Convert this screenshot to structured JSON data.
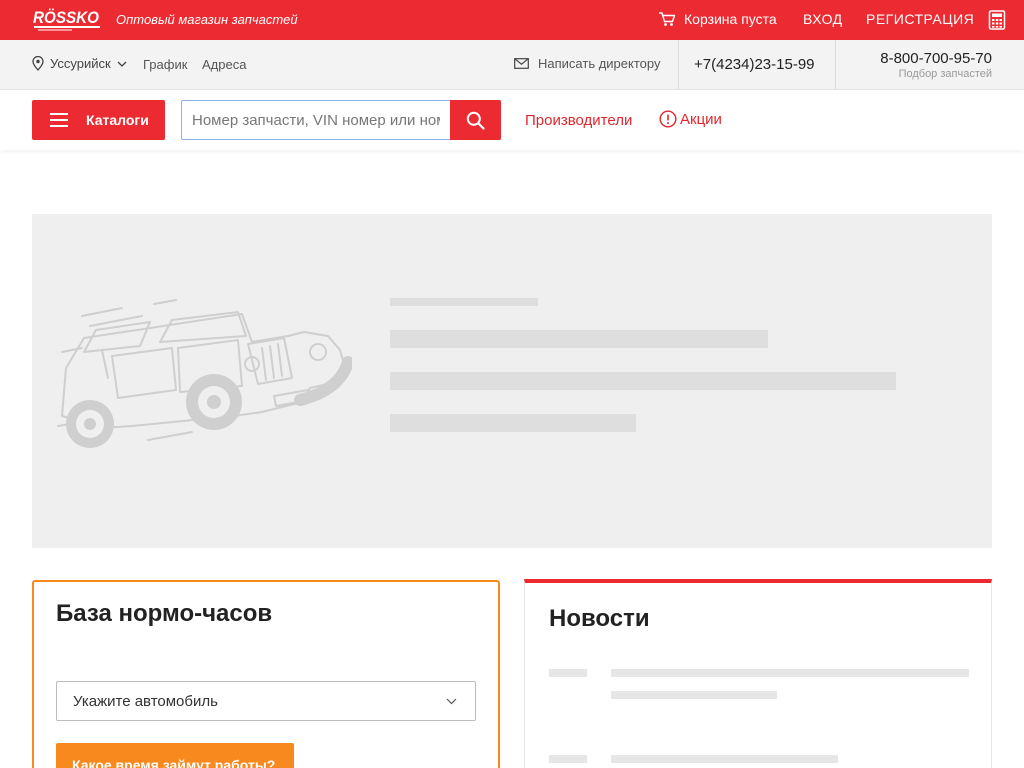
{
  "header": {
    "logo_text": "RÖSSKO",
    "tagline": "Оптовый магазин запчастей",
    "cart_label": "Корзина пуста",
    "login_label": "ВХОД",
    "register_label": "РЕГИСТРАЦИЯ",
    "brand_color": "#ec2a32"
  },
  "infobar": {
    "city": "Уссурийск",
    "schedule": "График",
    "addresses": "Адреса",
    "write_director": "Написать директору",
    "phone_local": "+7(4234)23-15-99",
    "phone_free": "8-800-700-95-70",
    "phone_free_caption": "Подбор запчастей"
  },
  "nav": {
    "catalog_label": "Каталоги",
    "search_placeholder": "Номер запчасти, VIN номер или номер кузова",
    "manufacturers_label": "Производители",
    "promo_label": "Акции"
  },
  "hours_card": {
    "title": "База нормо-часов",
    "car_select_value": "Укажите автомобиль",
    "button_label": "Какое время займут работы?",
    "accent_color": "#f7891f"
  },
  "news_card": {
    "title": "Новости"
  }
}
